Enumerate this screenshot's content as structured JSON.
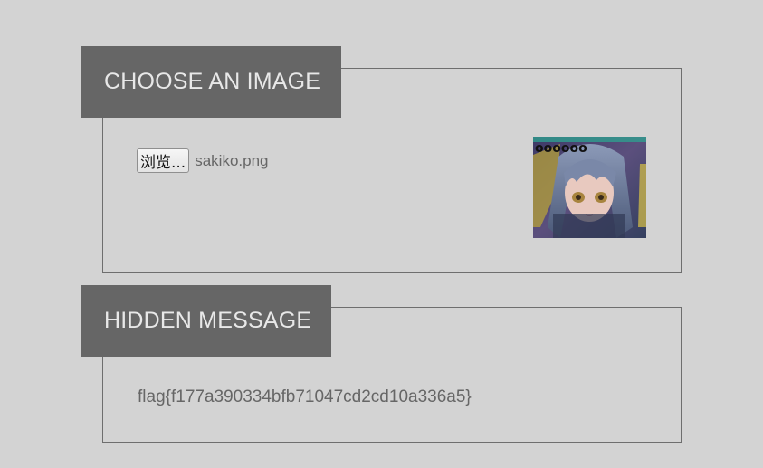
{
  "choose_section": {
    "title": "CHOOSE AN IMAGE",
    "browse_label": "浏览...",
    "file_name": "sakiko.png"
  },
  "hidden_section": {
    "title": "HIDDEN MESSAGE",
    "message": "flag{f177a390334bfb71047cd2cd10a336a5}"
  },
  "preview": {
    "icon": "anime-portrait-image",
    "overlay_text": "oooooo"
  },
  "colors": {
    "background": "#d3d3d3",
    "tab_background": "#666666",
    "tab_text": "#e8e8e8",
    "border": "#6e6e6e",
    "body_text": "#666666"
  }
}
